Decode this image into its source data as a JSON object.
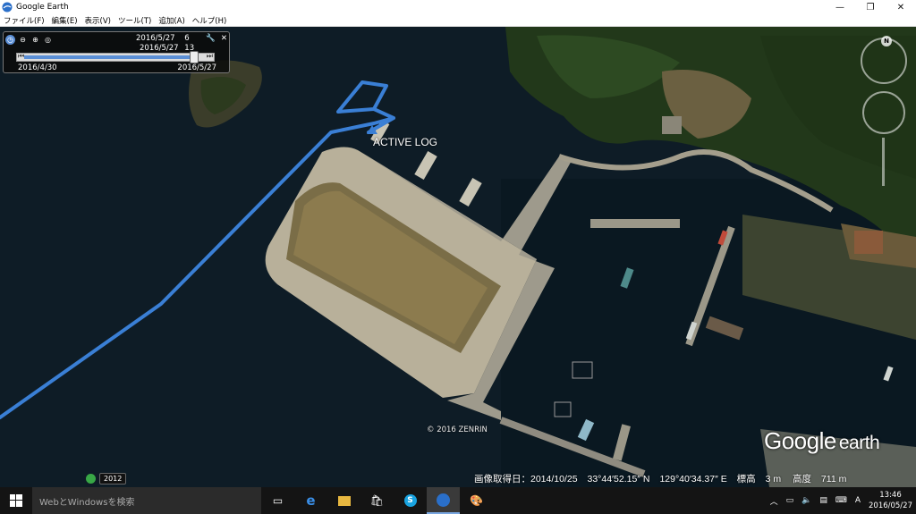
{
  "window": {
    "title": "Google Earth",
    "buttons": {
      "minimize": "—",
      "maximize": "❐",
      "close": "✕"
    }
  },
  "menu": [
    "ファイル(F)",
    "編集(E)",
    "表示(V)",
    "ツール(T)",
    "追加(A)",
    "ヘルプ(H)"
  ],
  "time_slider": {
    "current_date": "2016/5/27",
    "current_hour": "6",
    "current_date2": "2016/5/27",
    "current_hour2": "13",
    "start_date": "2016/4/30",
    "end_date": "2016/5/27",
    "position": 0.97
  },
  "map": {
    "track_label": "ACTIVE LOG",
    "copyright": "© 2016 ZENRIN",
    "logo_main": "Google",
    "logo_sub": "earth",
    "historical_year": "2012",
    "track_color": "#3a7fd5",
    "compass_n": "N"
  },
  "status_bar": {
    "image_date": "画像取得日：2014/10/25",
    "latitude": "33°44′52.15″ N",
    "longitude": "129°40′34.37″ E",
    "elevation_label": "標高",
    "elevation": "3 m",
    "altitude_label": "高度",
    "altitude": "711 m"
  },
  "taskbar": {
    "search_placeholder": "WebとWindowsを検索",
    "time": "13:46",
    "date": "2016/05/27",
    "ime": "A",
    "apps": [
      "task-view",
      "edge",
      "file-explorer",
      "store",
      "skype",
      "google-earth",
      "paint"
    ]
  }
}
